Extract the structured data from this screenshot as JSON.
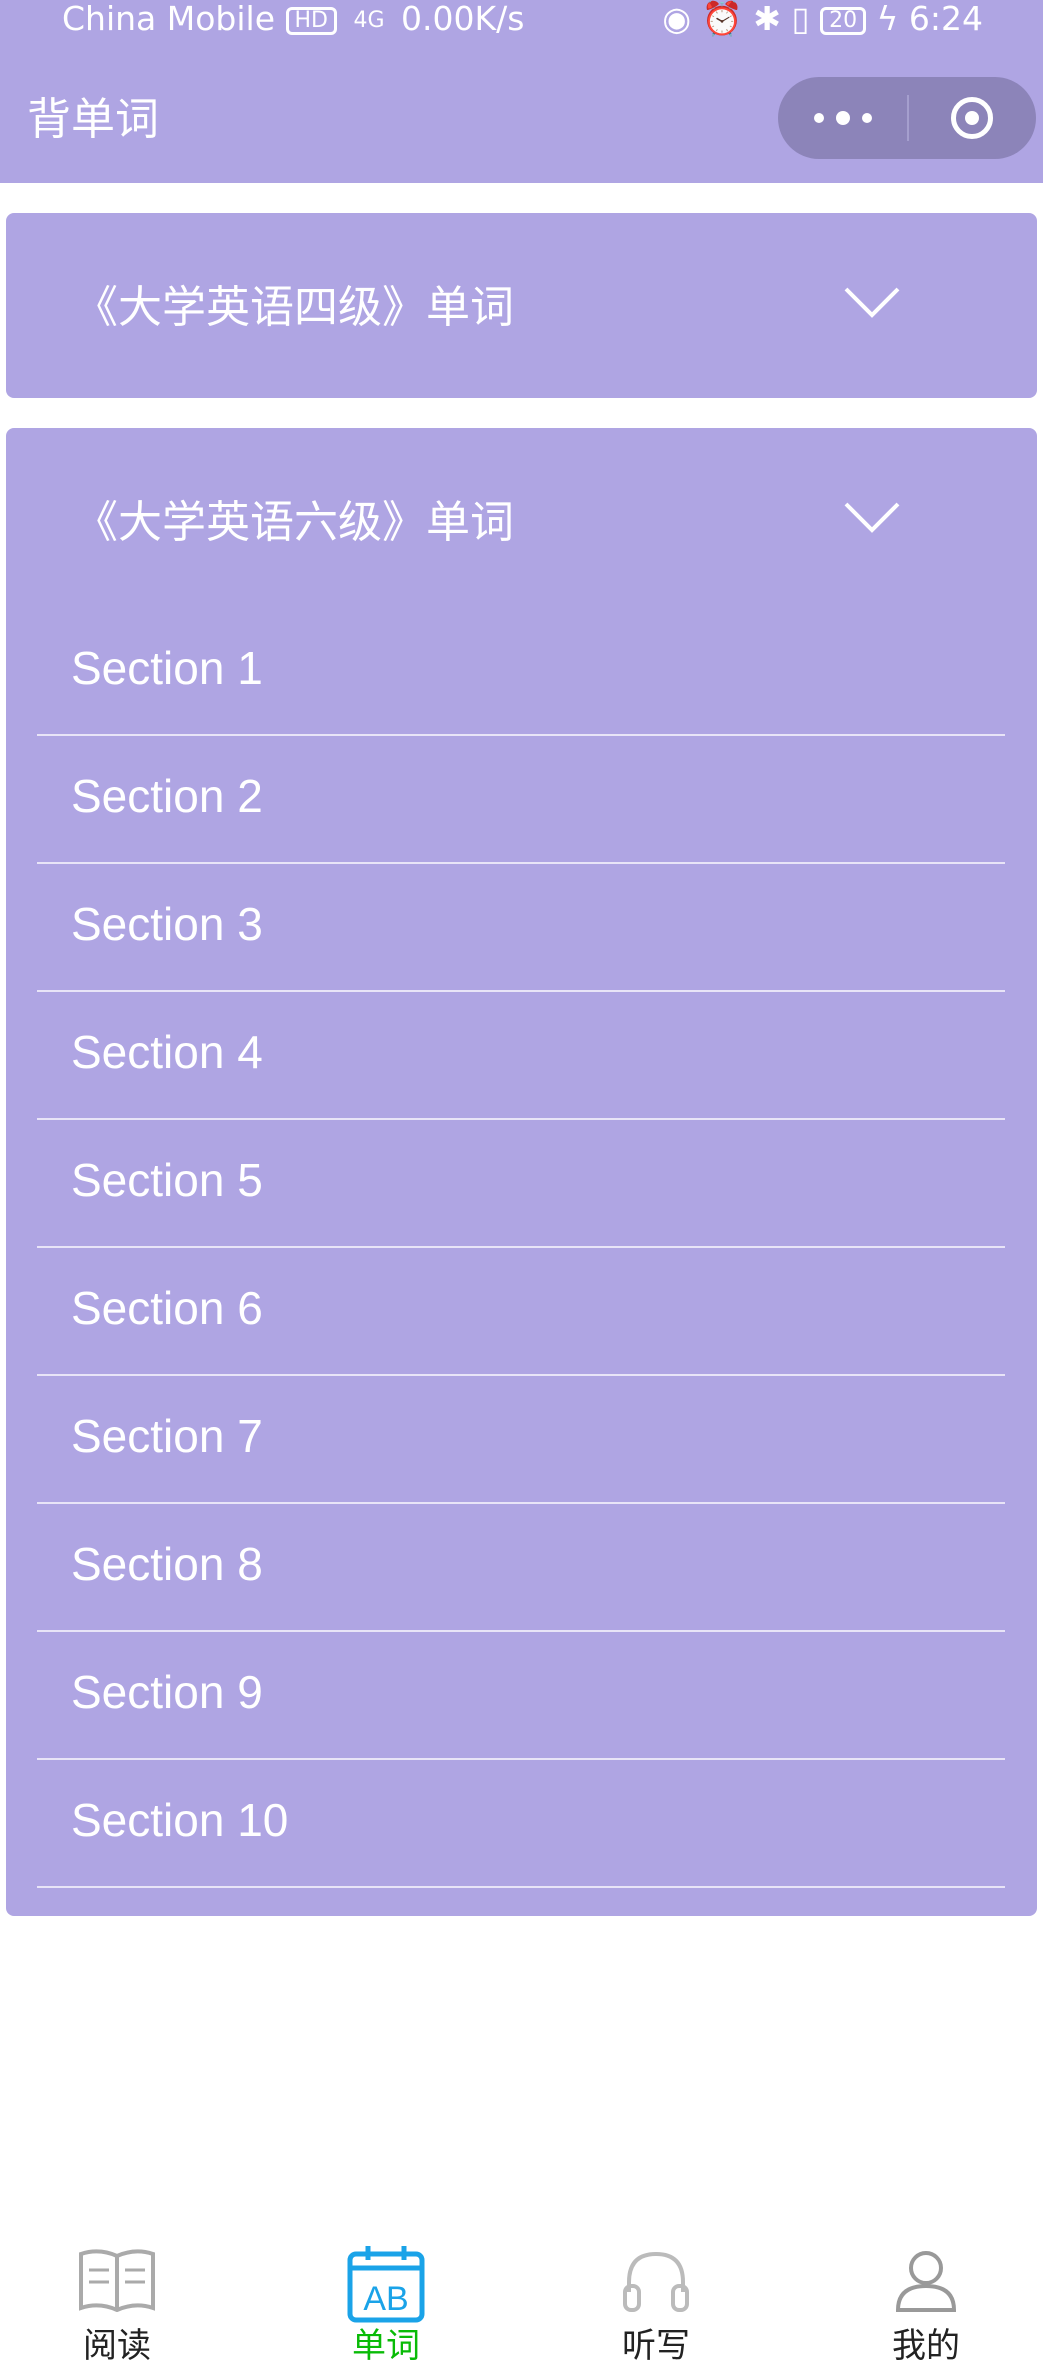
{
  "status_bar": {
    "carrier": "China Mobile",
    "hd": "HD",
    "network": "4G",
    "speed": "0.00K/s",
    "battery": "20",
    "time": "6:24"
  },
  "header": {
    "title": "背单词"
  },
  "accordion": [
    {
      "title": "《大学英语四级》单词",
      "expanded": false,
      "sections": []
    },
    {
      "title": "《大学英语六级》单词",
      "expanded": true,
      "sections": [
        "Section 1",
        "Section 2",
        "Section 3",
        "Section 4",
        "Section 5",
        "Section 6",
        "Section 7",
        "Section 8",
        "Section 9",
        "Section 10"
      ]
    }
  ],
  "tabbar": {
    "items": [
      {
        "label": "阅读",
        "icon": "book-icon",
        "active": false
      },
      {
        "label": "单词",
        "icon": "ab-calendar-icon",
        "active": true
      },
      {
        "label": "听写",
        "icon": "headphones-icon",
        "active": false
      },
      {
        "label": "我的",
        "icon": "person-icon",
        "active": false
      }
    ]
  },
  "colors": {
    "theme": "#afa5e3",
    "active_tab": "#09bb07",
    "active_icon": "#1aa3e8"
  }
}
